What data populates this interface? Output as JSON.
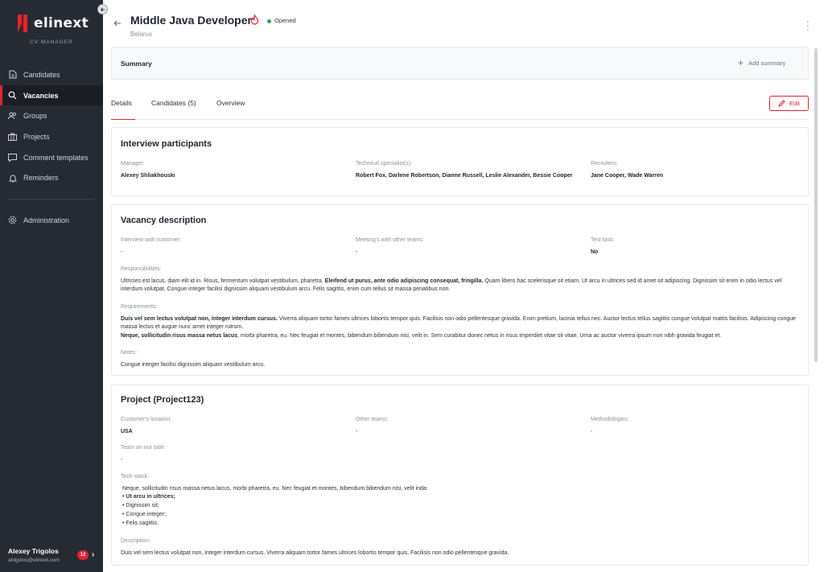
{
  "brand": {
    "logo_text": "elinext",
    "subtitle": "CV MANAGER",
    "accent": "#e1252f",
    "sidebar_bg": "#262b33"
  },
  "sidebar": {
    "items": [
      {
        "label": "Candidates",
        "icon": "document-icon"
      },
      {
        "label": "Vacancies",
        "icon": "search-icon",
        "active": true
      },
      {
        "label": "Groups",
        "icon": "users-icon"
      },
      {
        "label": "Projects",
        "icon": "briefcase-icon"
      },
      {
        "label": "Comment templates",
        "icon": "comment-icon"
      },
      {
        "label": "Reminders",
        "icon": "bell-icon"
      }
    ],
    "admin_label": "Administration",
    "user": {
      "name": "Alexey Trigolos",
      "email": "atrigolos@elinext.com",
      "badge": "12"
    }
  },
  "header": {
    "title": "Middle Java Developer",
    "status": "Opened",
    "status_color": "#2aa55a",
    "location": "Belarus"
  },
  "summary": {
    "title": "Summary",
    "add_label": "Add summary"
  },
  "tabs": [
    {
      "label": "Details",
      "active": true
    },
    {
      "label": "Candidates (5)"
    },
    {
      "label": "Overview"
    }
  ],
  "edit_label": "Edit",
  "participants": {
    "title": "Interview participants",
    "manager_label": "Manager:",
    "manager": "Alexey Shliakhouski",
    "tech_label": "Technical specialist(s):",
    "tech": "Robert Fox, Darlene Robertson, Dianne Russell, Leslie Alexander, Bessie Cooper",
    "recruiters_label": "Recruiters:",
    "recruiters": "Jane Cooper, Wade Warren"
  },
  "vacancy": {
    "title": "Vacancy description",
    "interview_label": "Interview with customer:",
    "interview": "-",
    "meetings_label": "Meeting's with other teams:",
    "meetings": "-",
    "test_label": "Test task:",
    "test": "No",
    "resp_label": "Responsibilities:",
    "resp_1": "Ultricies est lacus, diam elit id in. Risus, fermentum volutpat vestibulum, pharetra. ",
    "resp_bold": "Eleifend ut purus, ante odio adipiscing consequat, fringilla.",
    "resp_2": " Quam libero hac scelerisque sit etiam. Ut arcu in ultrices sed id amet sit adipiscing. Dignissim sit enim in odio lectus vel interdum volutpat. Congue integer facilisi dignissim aliquam vestibulum arcu. Felis sagittis, enim cum tellus sit massa penatibus non.",
    "req_label": "Requirements:",
    "req_bold_1": "Duis vel sem lectus volutpat non, integer interdum cursus.",
    "req_1": " Viverra aliquam tortor fames ultrices lobortis tempor quis. Facilisis non odio pellentesque gravida. Enim pretium, lacinia tellus nec. Auctor lectus tellus sagittis congue volutpat mattis facilisis. Adipiscing congue massa lectus et augue nunc amet integer rutrum.",
    "req_bold_2": "Neque, sollicitudin risus massa netus lacus",
    "req_2": ", morbi pharetra, eu. Nec feugiat et montes, bibendum bibendum nisi, velit in. Sem curabitur donec netus in risus imperdiet vitae sit vitae. Urna ac auctor viverra ipsum non nibh gravida feugiat et.",
    "notes_label": "Notes:",
    "notes": "Congue integer facilisi dignissim aliquam vestibulum arcu."
  },
  "project": {
    "title": "Project (Project123)",
    "location_label": "Customer's location:",
    "location": "USA",
    "other_label": "Other teams:",
    "other": "-",
    "method_label": "Methodologies:",
    "method": "-",
    "team_label": "Team on our side:",
    "team": "-",
    "stack_label": "Tech stack:",
    "stack_intro": "Neque, sollicitudin risus massa netus lacus, morbi pharetra, eu. Nec feugiat et montes, bibendum bibendum nisi, velit inda:",
    "stack_items": [
      "Ut arcu in ultrices;",
      "Dignissim sit;",
      "Congue integer;",
      "Felis sagittis."
    ],
    "desc_label": "Description:",
    "desc": "Duis vel sem lectus volutpat non, integer interdum cursus. Viverra aliquam tortor fames ultrices lobortis tempor quis. Facilisis non odio pellentesque gravida."
  }
}
